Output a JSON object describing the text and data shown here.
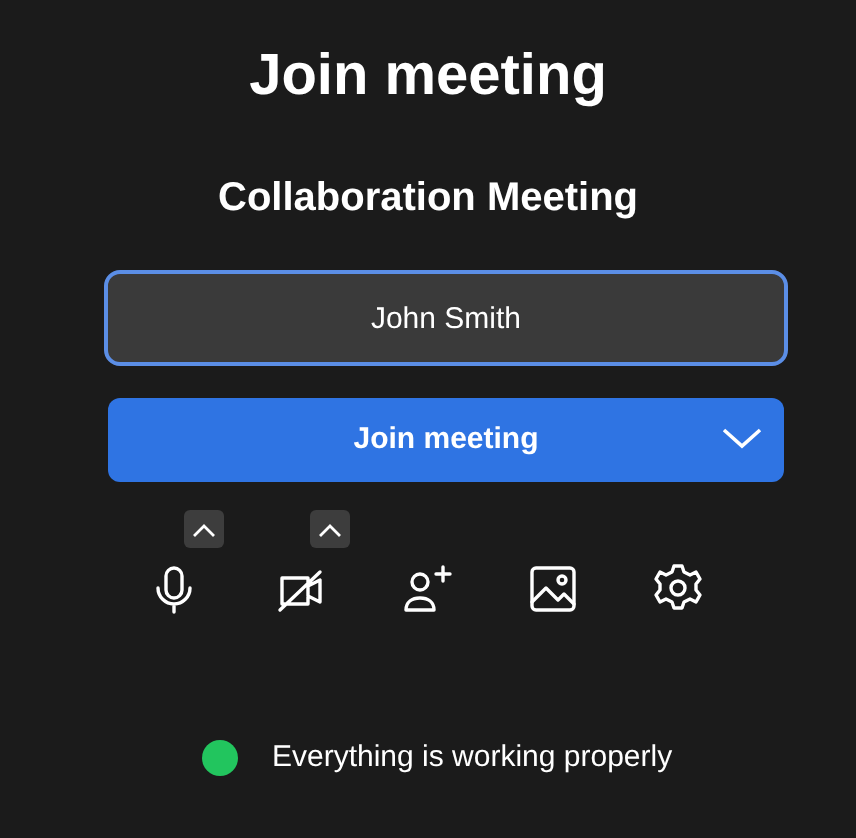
{
  "title": "Join meeting",
  "meeting_name": "Collaboration Meeting",
  "name_field": {
    "value": "John Smith"
  },
  "join_button": {
    "label": "Join meeting"
  },
  "toolbar": [
    {
      "kind": "microphone",
      "has_menu": true
    },
    {
      "kind": "camera-off",
      "has_menu": true
    },
    {
      "kind": "add-person",
      "has_menu": false
    },
    {
      "kind": "background",
      "has_menu": false
    },
    {
      "kind": "settings",
      "has_menu": false
    }
  ],
  "status": {
    "text": "Everything is working properly",
    "color": "#22c55e"
  }
}
